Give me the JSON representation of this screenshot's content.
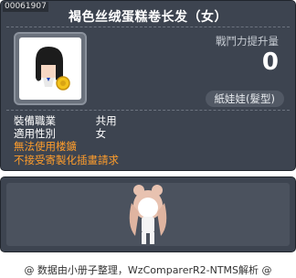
{
  "item": {
    "id": "00061907",
    "title": "褐色丝绒蛋糕卷长发（女）",
    "stat_label": "戰鬥力提升量",
    "stat_value": "0",
    "type_label": "紙娃娃(髮型)"
  },
  "info": {
    "rows": [
      {
        "key": "裝備職業",
        "value": "共用"
      },
      {
        "key": "適用性別",
        "value": "女"
      }
    ],
    "warnings": [
      "無法使用楼鑛",
      "不接受寄製化插畫請求"
    ]
  },
  "footer": {
    "text": "@ 数据由小册子整理，WzComparerR2-NTMS解析 @"
  },
  "colors": {
    "panel": "#3d4450",
    "warning": "#ff9d2b",
    "text": "#ffffff"
  }
}
